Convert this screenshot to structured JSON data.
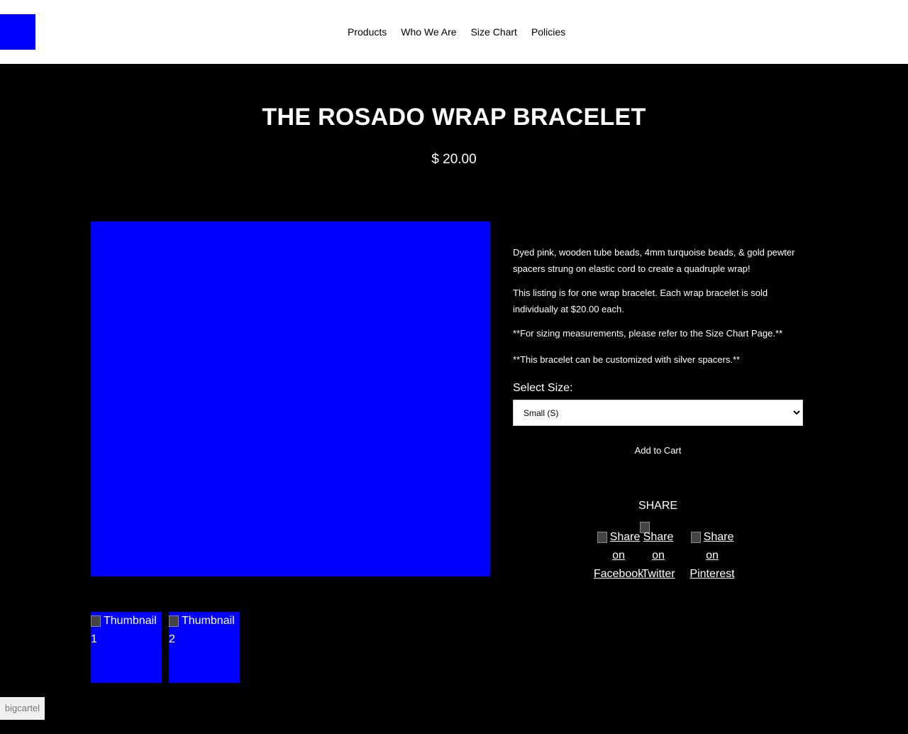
{
  "nav": {
    "items": [
      "Products",
      "Who We Are",
      "Size Chart",
      "Policies"
    ]
  },
  "product": {
    "title": "THE ROSADO WRAP BRACELET",
    "price": "$ 20.00",
    "description": [
      "Dyed pink, wooden tube beads, 4mm turquoise beads, & gold pewter spacers strung on elastic cord to create a quadruple wrap!",
      "This listing is for one wrap bracelet. Each wrap bracelet is sold individually at $20.00 each.",
      "**For sizing measurements, please refer to the Size Chart Page.**",
      "**This bracelet can be customized with silver spacers.**"
    ],
    "size_label": "Select Size:",
    "size_selected": "Small (S)",
    "add_to_cart": "Add to Cart"
  },
  "share": {
    "label": "SHARE",
    "facebook": "Share on Facebook",
    "twitter": "Share on Twitter",
    "pinterest": "Share on Pinterest"
  },
  "thumbnails": [
    "Thumbnail 1",
    "Thumbnail 2"
  ],
  "badge": "bigcartel",
  "colors": {
    "image_placeholder": "#0000ff",
    "background": "#000000",
    "header": "#ffffff"
  }
}
